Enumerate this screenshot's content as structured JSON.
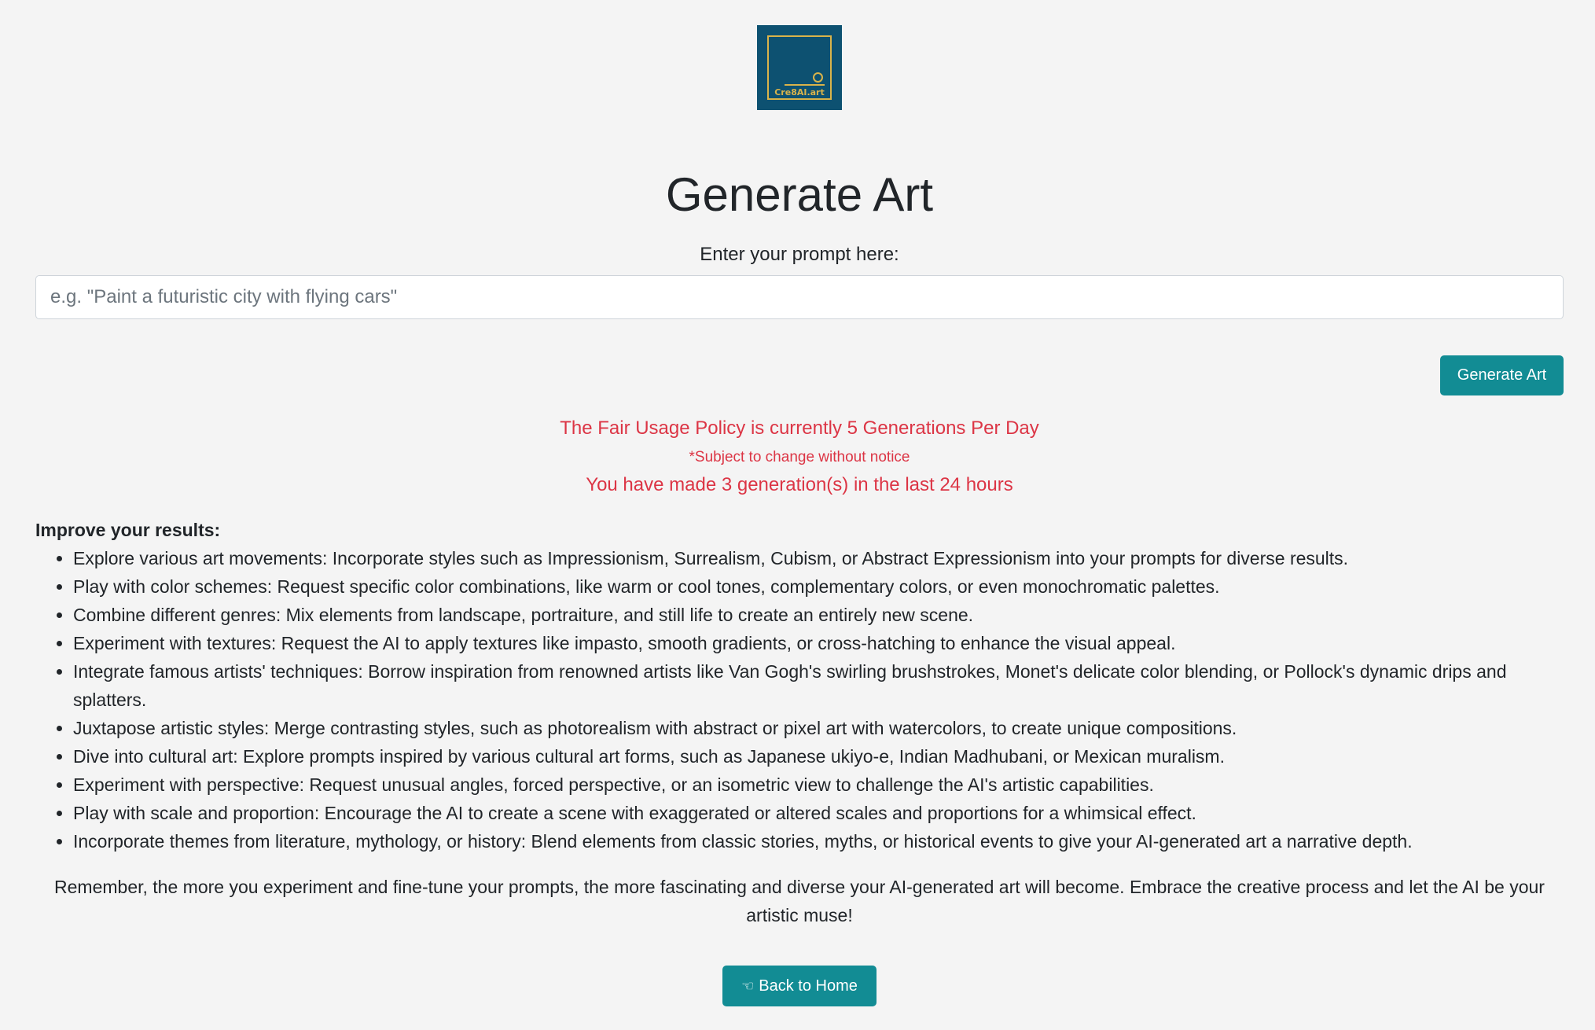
{
  "logo": {
    "text": "Cre8AI.art",
    "background": "#0d5171",
    "accent": "#d9b34a"
  },
  "page": {
    "title": "Generate Art"
  },
  "prompt": {
    "label": "Enter your prompt here:",
    "value": "",
    "placeholder": "e.g. \"Paint a futuristic city with flying cars\""
  },
  "generate_button": {
    "label": "Generate Art"
  },
  "policy": {
    "line1": "The Fair Usage Policy is currently 5 Generations Per Day",
    "line2": "*Subject to change without notice",
    "line3": "You have made 3 generation(s) in the last 24 hours",
    "color": "#dc3545"
  },
  "tips": {
    "title": "Improve your results:",
    "items": [
      "Explore various art movements: Incorporate styles such as Impressionism, Surrealism, Cubism, or Abstract Expressionism into your prompts for diverse results.",
      "Play with color schemes: Request specific color combinations, like warm or cool tones, complementary colors, or even monochromatic palettes.",
      "Combine different genres: Mix elements from landscape, portraiture, and still life to create an entirely new scene.",
      "Experiment with textures: Request the AI to apply textures like impasto, smooth gradients, or cross-hatching to enhance the visual appeal.",
      "Integrate famous artists' techniques: Borrow inspiration from renowned artists like Van Gogh's swirling brushstrokes, Monet's delicate color blending, or Pollock's dynamic drips and splatters.",
      "Juxtapose artistic styles: Merge contrasting styles, such as photorealism with abstract or pixel art with watercolors, to create unique compositions.",
      "Dive into cultural art: Explore prompts inspired by various cultural art forms, such as Japanese ukiyo-e, Indian Madhubani, or Mexican muralism.",
      "Experiment with perspective: Request unusual angles, forced perspective, or an isometric view to challenge the AI's artistic capabilities.",
      "Play with scale and proportion: Encourage the AI to create a scene with exaggerated or altered scales and proportions for a whimsical effect.",
      "Incorporate themes from literature, mythology, or history: Blend elements from classic stories, myths, or historical events to give your AI-generated art a narrative depth."
    ]
  },
  "remember": "Remember, the more you experiment and fine-tune your prompts, the more fascinating and diverse your AI-generated art will become. Embrace the creative process and let the AI be your artistic muse!",
  "home_button": {
    "label": "Back to Home",
    "icon": "hand-pointing-left-icon"
  },
  "colors": {
    "button": "#128c94",
    "background": "#f4f4f4"
  }
}
